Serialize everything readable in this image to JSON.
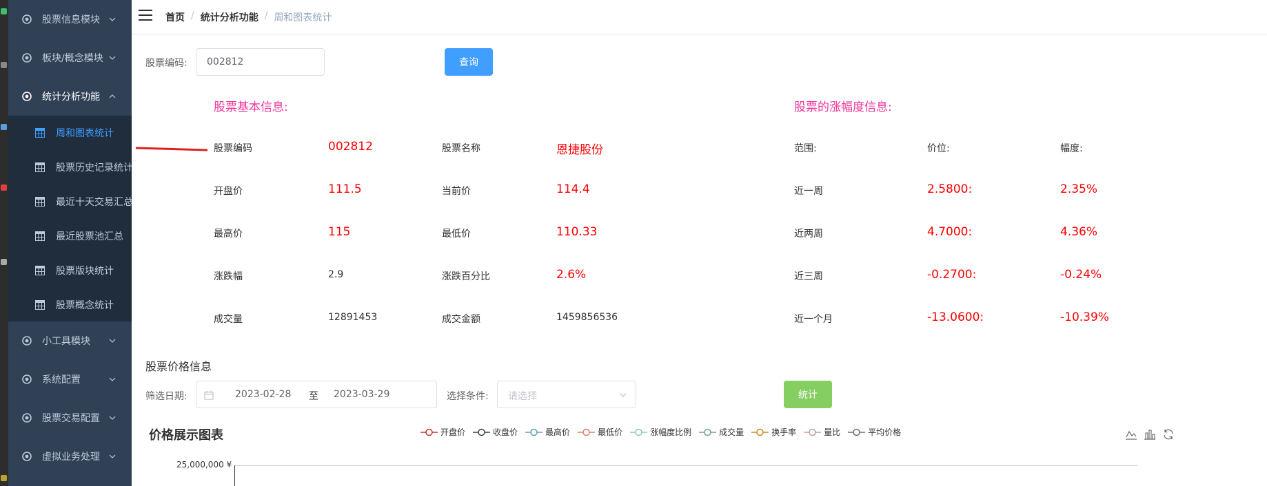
{
  "sidebar": {
    "items": [
      {
        "label": "股票信息模块"
      },
      {
        "label": "板块/概念模块"
      },
      {
        "label": "统计分析功能"
      },
      {
        "label": "小工具模块"
      },
      {
        "label": "系统配置"
      },
      {
        "label": "股票交易配置"
      },
      {
        "label": "虚拟业务处理"
      }
    ],
    "subitems": [
      {
        "label": "周和图表统计"
      },
      {
        "label": "股票历史记录统计"
      },
      {
        "label": "最近十天交易汇总"
      },
      {
        "label": "最近股票池汇总"
      },
      {
        "label": "股票版块统计"
      },
      {
        "label": "股票概念统计"
      }
    ],
    "active_color": "#409eff"
  },
  "breadcrumb": [
    "首页",
    "统计分析功能",
    "周和图表统计"
  ],
  "search": {
    "code_label": "股票编码:",
    "code_value": "002812",
    "query_button": "查询"
  },
  "basic_info": {
    "title": "股票基本信息:",
    "rows": [
      {
        "k1": "股票编码",
        "v1": "002812",
        "k2": "股票名称",
        "v2": "恩捷股份"
      },
      {
        "k1": "开盘价",
        "v1": "111.5",
        "k2": "当前价",
        "v2": "114.4"
      },
      {
        "k1": "最高价",
        "v1": "115",
        "k2": "最低价",
        "v2": "110.33"
      },
      {
        "k1": "涨跌幅",
        "v1": "2.9",
        "k2": "涨跌百分比",
        "v2": "2.6%"
      },
      {
        "k1": "成交量",
        "v1": "12891453",
        "k2": "成交金额",
        "v2": "1459856536"
      }
    ]
  },
  "change_info": {
    "title": "股票的涨幅度信息:",
    "headers": [
      "范围:",
      "价位:",
      "幅度:"
    ],
    "rows": [
      {
        "range": "近一周",
        "price": "2.5800:",
        "pct": "2.35%"
      },
      {
        "range": "近两周",
        "price": "4.7000:",
        "pct": "4.36%"
      },
      {
        "range": "近三周",
        "price": "-0.2700:",
        "pct": "-0.24%"
      },
      {
        "range": "近一个月",
        "price": "-13.0600:",
        "pct": "-10.39%"
      }
    ]
  },
  "price_section": {
    "title": "股票价格信息",
    "date_label": "筛选日期:",
    "start_date": "2023-02-28",
    "range_sep": "至",
    "end_date": "2023-03-29",
    "condition_label": "选择条件:",
    "condition_placeholder": "请选择",
    "stat_button": "统计"
  },
  "chart": {
    "title": "价格展示图表",
    "legend": [
      {
        "name": "开盘价",
        "color": "#c23531"
      },
      {
        "name": "收盘价",
        "color": "#2f4554"
      },
      {
        "name": "最高价",
        "color": "#61a0a8"
      },
      {
        "name": "最低价",
        "color": "#d48265"
      },
      {
        "name": "涨幅度比例",
        "color": "#91c7ae"
      },
      {
        "name": "成交量",
        "color": "#749f83"
      },
      {
        "name": "换手率",
        "color": "#ca8622"
      },
      {
        "name": "量比",
        "color": "#bda29a"
      },
      {
        "name": "平均价格",
        "color": "#6e7074"
      }
    ],
    "y_top_label": "25,000,000 ¥",
    "toolbox": [
      "line-chart-icon",
      "bar-chart-icon",
      "restore-icon"
    ]
  }
}
